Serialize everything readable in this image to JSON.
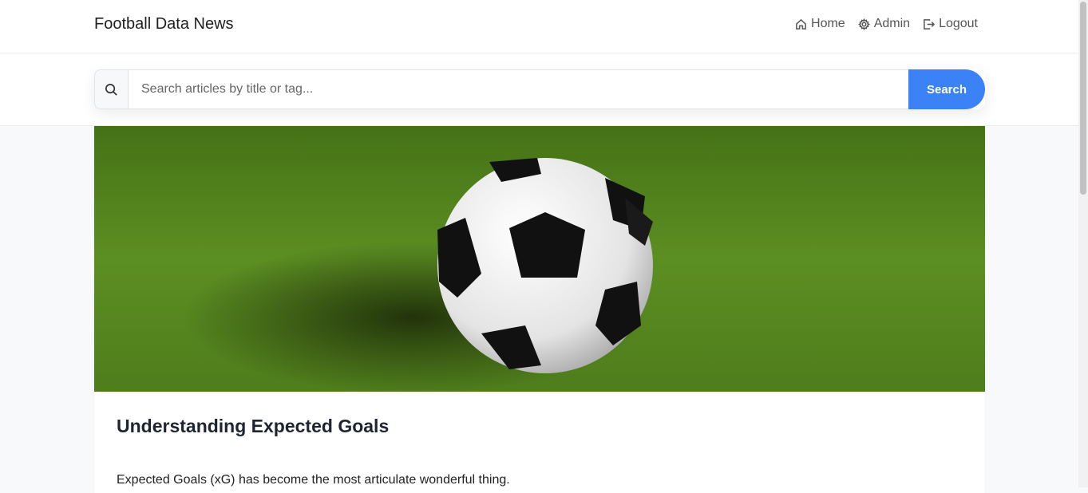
{
  "header": {
    "brand": "Football Data News",
    "nav": [
      {
        "label": "Home",
        "icon": "home-icon"
      },
      {
        "label": "Admin",
        "icon": "gear-icon"
      },
      {
        "label": "Logout",
        "icon": "logout-icon"
      }
    ]
  },
  "search": {
    "placeholder": "Search articles by title or tag...",
    "value": "",
    "button_label": "Search",
    "icon": "search-icon"
  },
  "article": {
    "image_subject": "football-on-grass",
    "title": "Understanding Expected Goals",
    "excerpt": "Expected Goals (xG) has become the most articulate wonderful thing."
  },
  "colors": {
    "accent": "#3b82f6",
    "title": "#1e2432",
    "grass": "#4a7a1c"
  }
}
